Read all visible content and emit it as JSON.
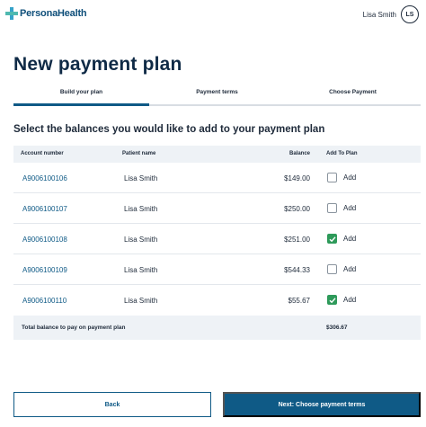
{
  "header": {
    "brand": "PersonaHealth",
    "user_name": "Lisa Smith",
    "user_initials": "LS"
  },
  "page_title": "New payment plan",
  "steps": [
    {
      "label": "Build your plan",
      "active": true
    },
    {
      "label": "Payment terms",
      "active": false
    },
    {
      "label": "Choose Payment",
      "active": false
    }
  ],
  "subtitle": "Select the balances you would like to add to your payment plan",
  "table": {
    "headers": {
      "account": "Account number",
      "patient": "Patient name",
      "balance": "Balance",
      "add": "Add To Plan"
    },
    "rows": [
      {
        "account": "A9006100106",
        "patient": "Lisa Smith",
        "balance": "$149.00",
        "checked": false,
        "add_label": "Add"
      },
      {
        "account": "A9006100107",
        "patient": "Lisa Smith",
        "balance": "$250.00",
        "checked": false,
        "add_label": "Add"
      },
      {
        "account": "A9006100108",
        "patient": "Lisa Smith",
        "balance": "$251.00",
        "checked": true,
        "add_label": "Add"
      },
      {
        "account": "A9006100109",
        "patient": "Lisa Smith",
        "balance": "$544.33",
        "checked": false,
        "add_label": "Add"
      },
      {
        "account": "A9006100110",
        "patient": "Lisa Smith",
        "balance": "$55.67",
        "checked": true,
        "add_label": "Add"
      }
    ],
    "total_label": "Total balance to pay on payment plan",
    "total_value": "$306.67"
  },
  "buttons": {
    "back": "Back",
    "next": "Next: Choose payment terms"
  },
  "colors": {
    "primary": "#0f5a86",
    "check_green": "#2e9a5a",
    "table_header_bg": "#eef2f6"
  }
}
